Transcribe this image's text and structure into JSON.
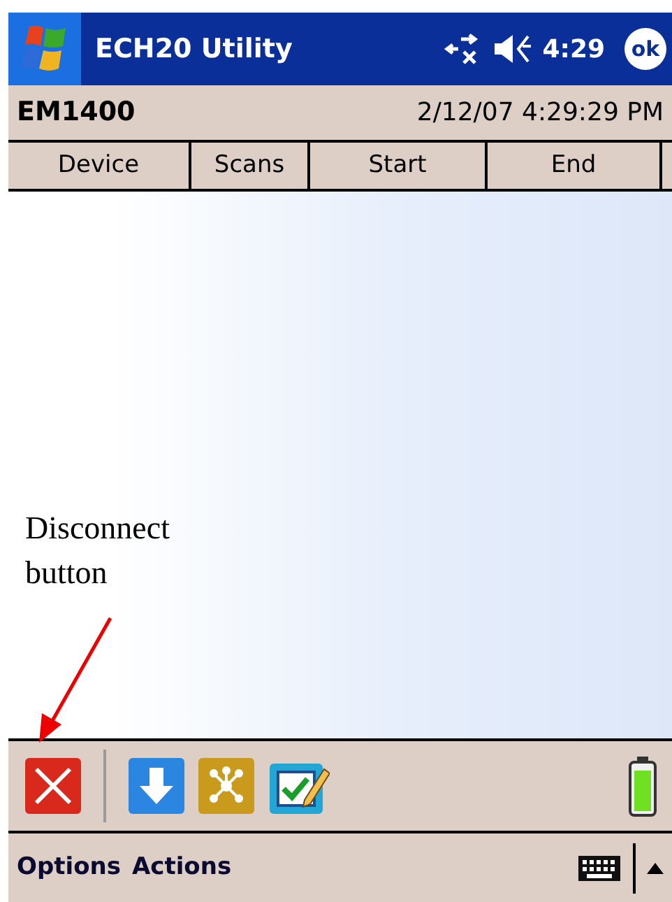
{
  "title_bar": {
    "title": "ECH20 Utility",
    "time": "4:29",
    "ok": "ok"
  },
  "info_bar": {
    "device": "EM1400",
    "datetime": "2/12/07 4:29:29 PM"
  },
  "table": {
    "columns": [
      "Device",
      "Scans",
      "Start",
      "End"
    ]
  },
  "annotation": {
    "text": "Disconnect\nbutton"
  },
  "toolbar": {
    "buttons": [
      {
        "kind": "disconnect"
      },
      {
        "kind": "separator"
      },
      {
        "kind": "download"
      },
      {
        "kind": "network"
      },
      {
        "kind": "edit"
      }
    ]
  },
  "menu_bar": {
    "items": [
      "Options",
      "Actions"
    ]
  }
}
